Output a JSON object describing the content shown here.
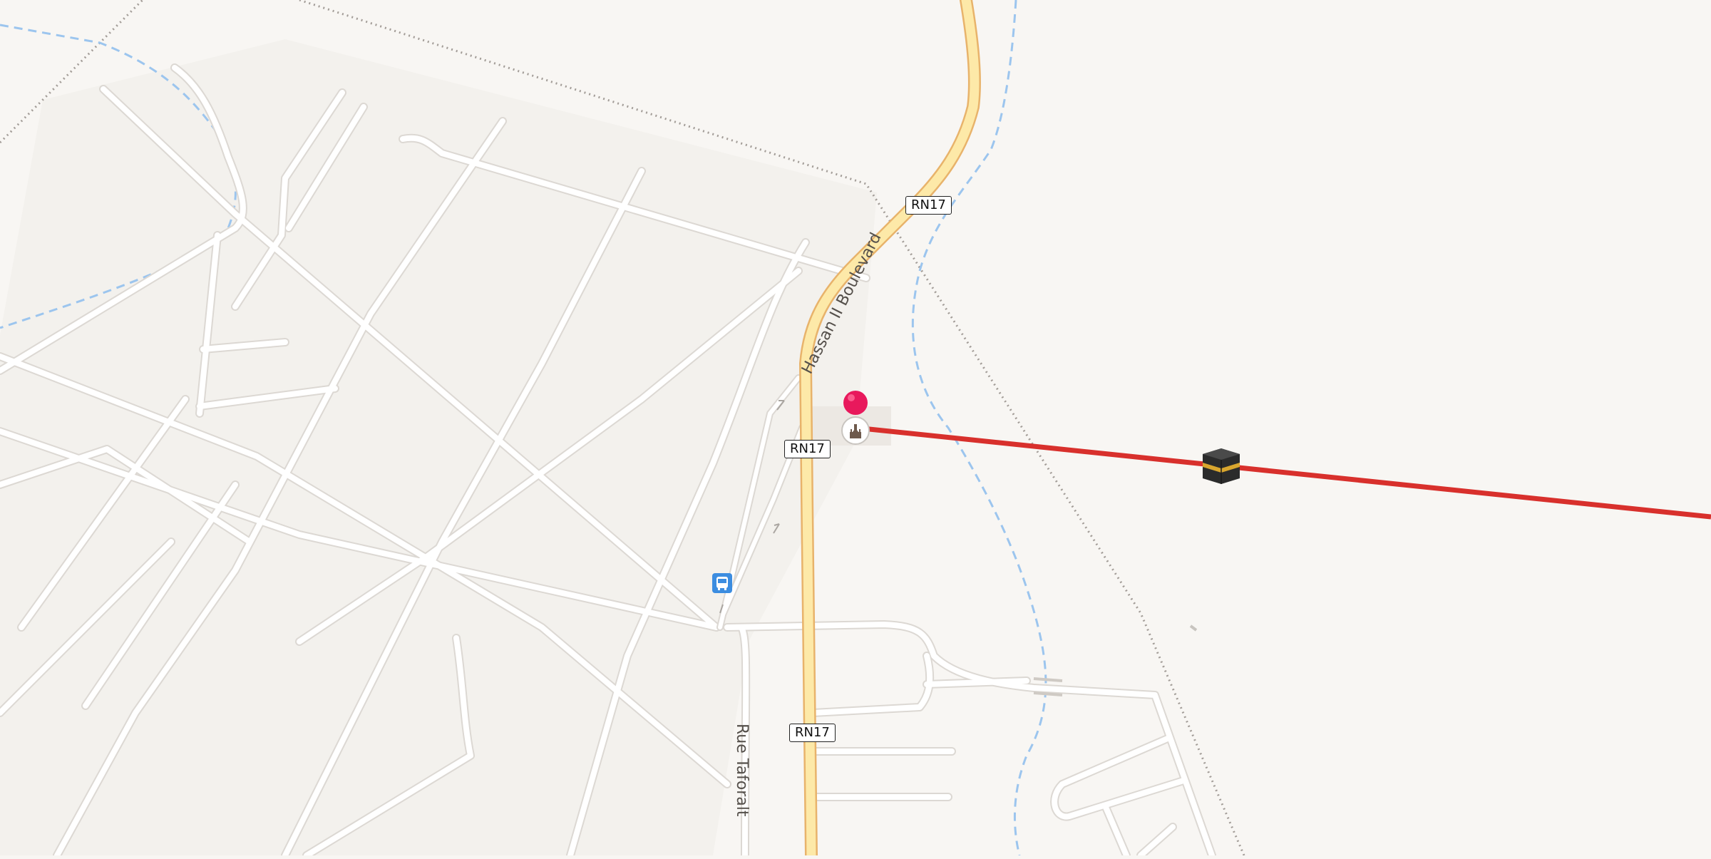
{
  "map": {
    "colors": {
      "background": "#f8f6f3",
      "landuse": "#f2efeb",
      "minor_road": "#ffffff",
      "minor_road_casing": "#dcd8d3",
      "primary_road": "#fde9a8",
      "primary_road_casing": "#e8b36b",
      "waterway": "#9cc5ee",
      "boundary": "#a39d98",
      "qibla_line": "#d8302c",
      "pin": "#e8195c",
      "bus_stop": "#3c8de0"
    },
    "labels": {
      "road_boulevard": "Hassan II Boulevard",
      "road_street": "Rue Taforalt"
    },
    "shields": [
      {
        "text": "RN17"
      },
      {
        "text": "RN17"
      },
      {
        "text": "RN17"
      }
    ],
    "icons": {
      "location_pin": "map-pin-icon",
      "place": "mosque-icon",
      "qibla": "kaaba-icon",
      "bus": "bus-stop-icon"
    }
  }
}
